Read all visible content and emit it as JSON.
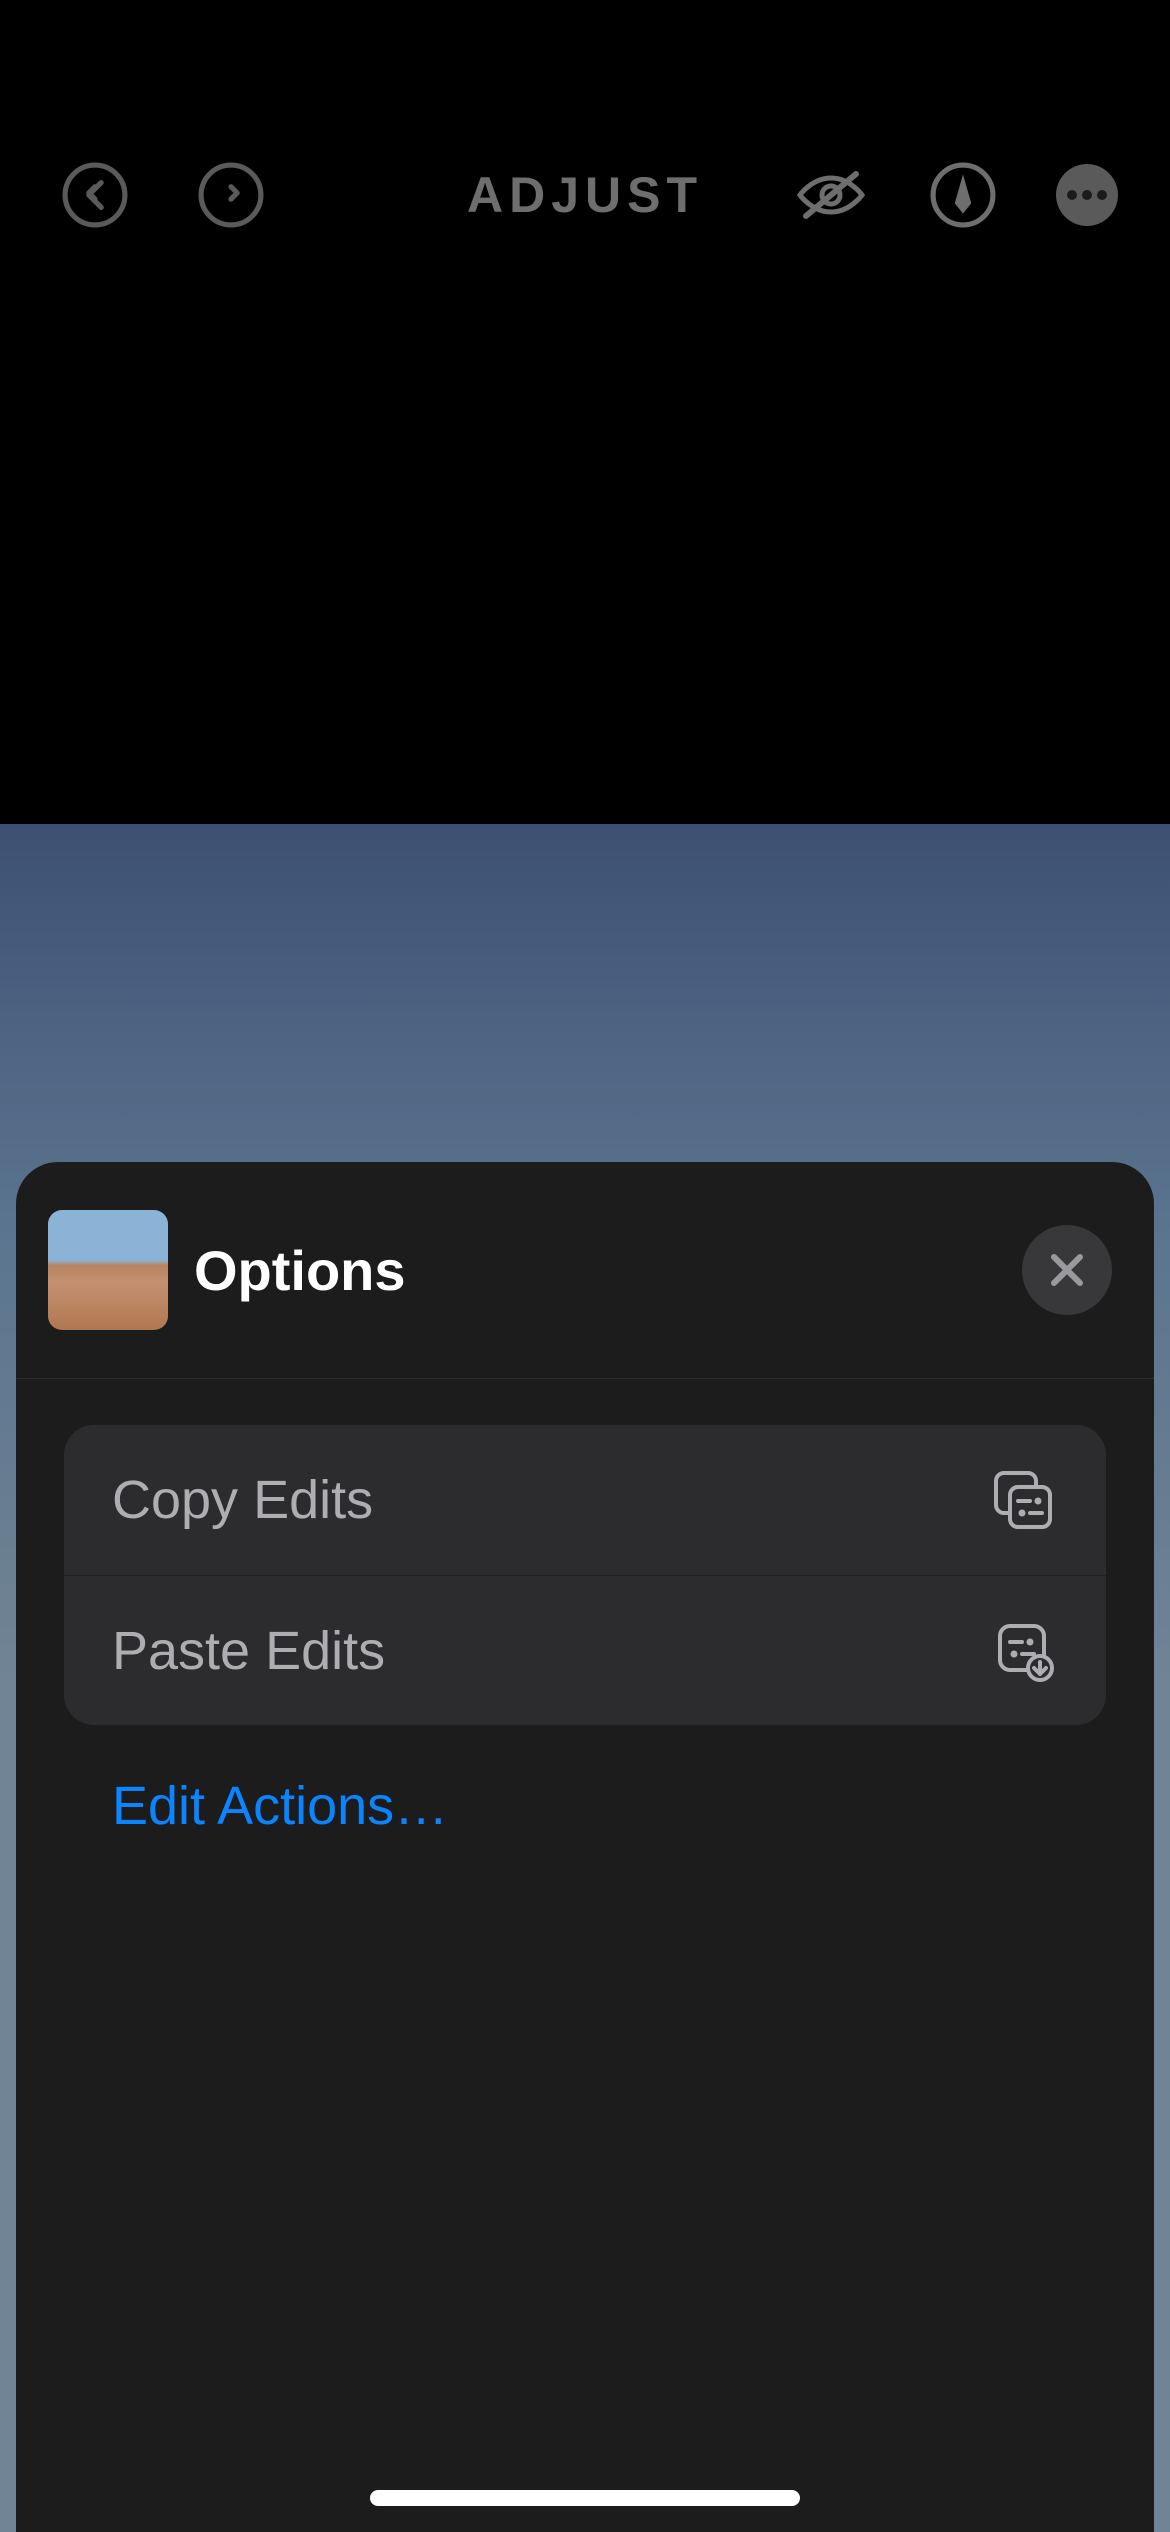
{
  "toolbar": {
    "title": "ADJUST"
  },
  "sheet": {
    "title": "Options",
    "rows": {
      "copy": "Copy Edits",
      "paste": "Paste Edits"
    },
    "edit_actions": "Edit Actions…"
  }
}
